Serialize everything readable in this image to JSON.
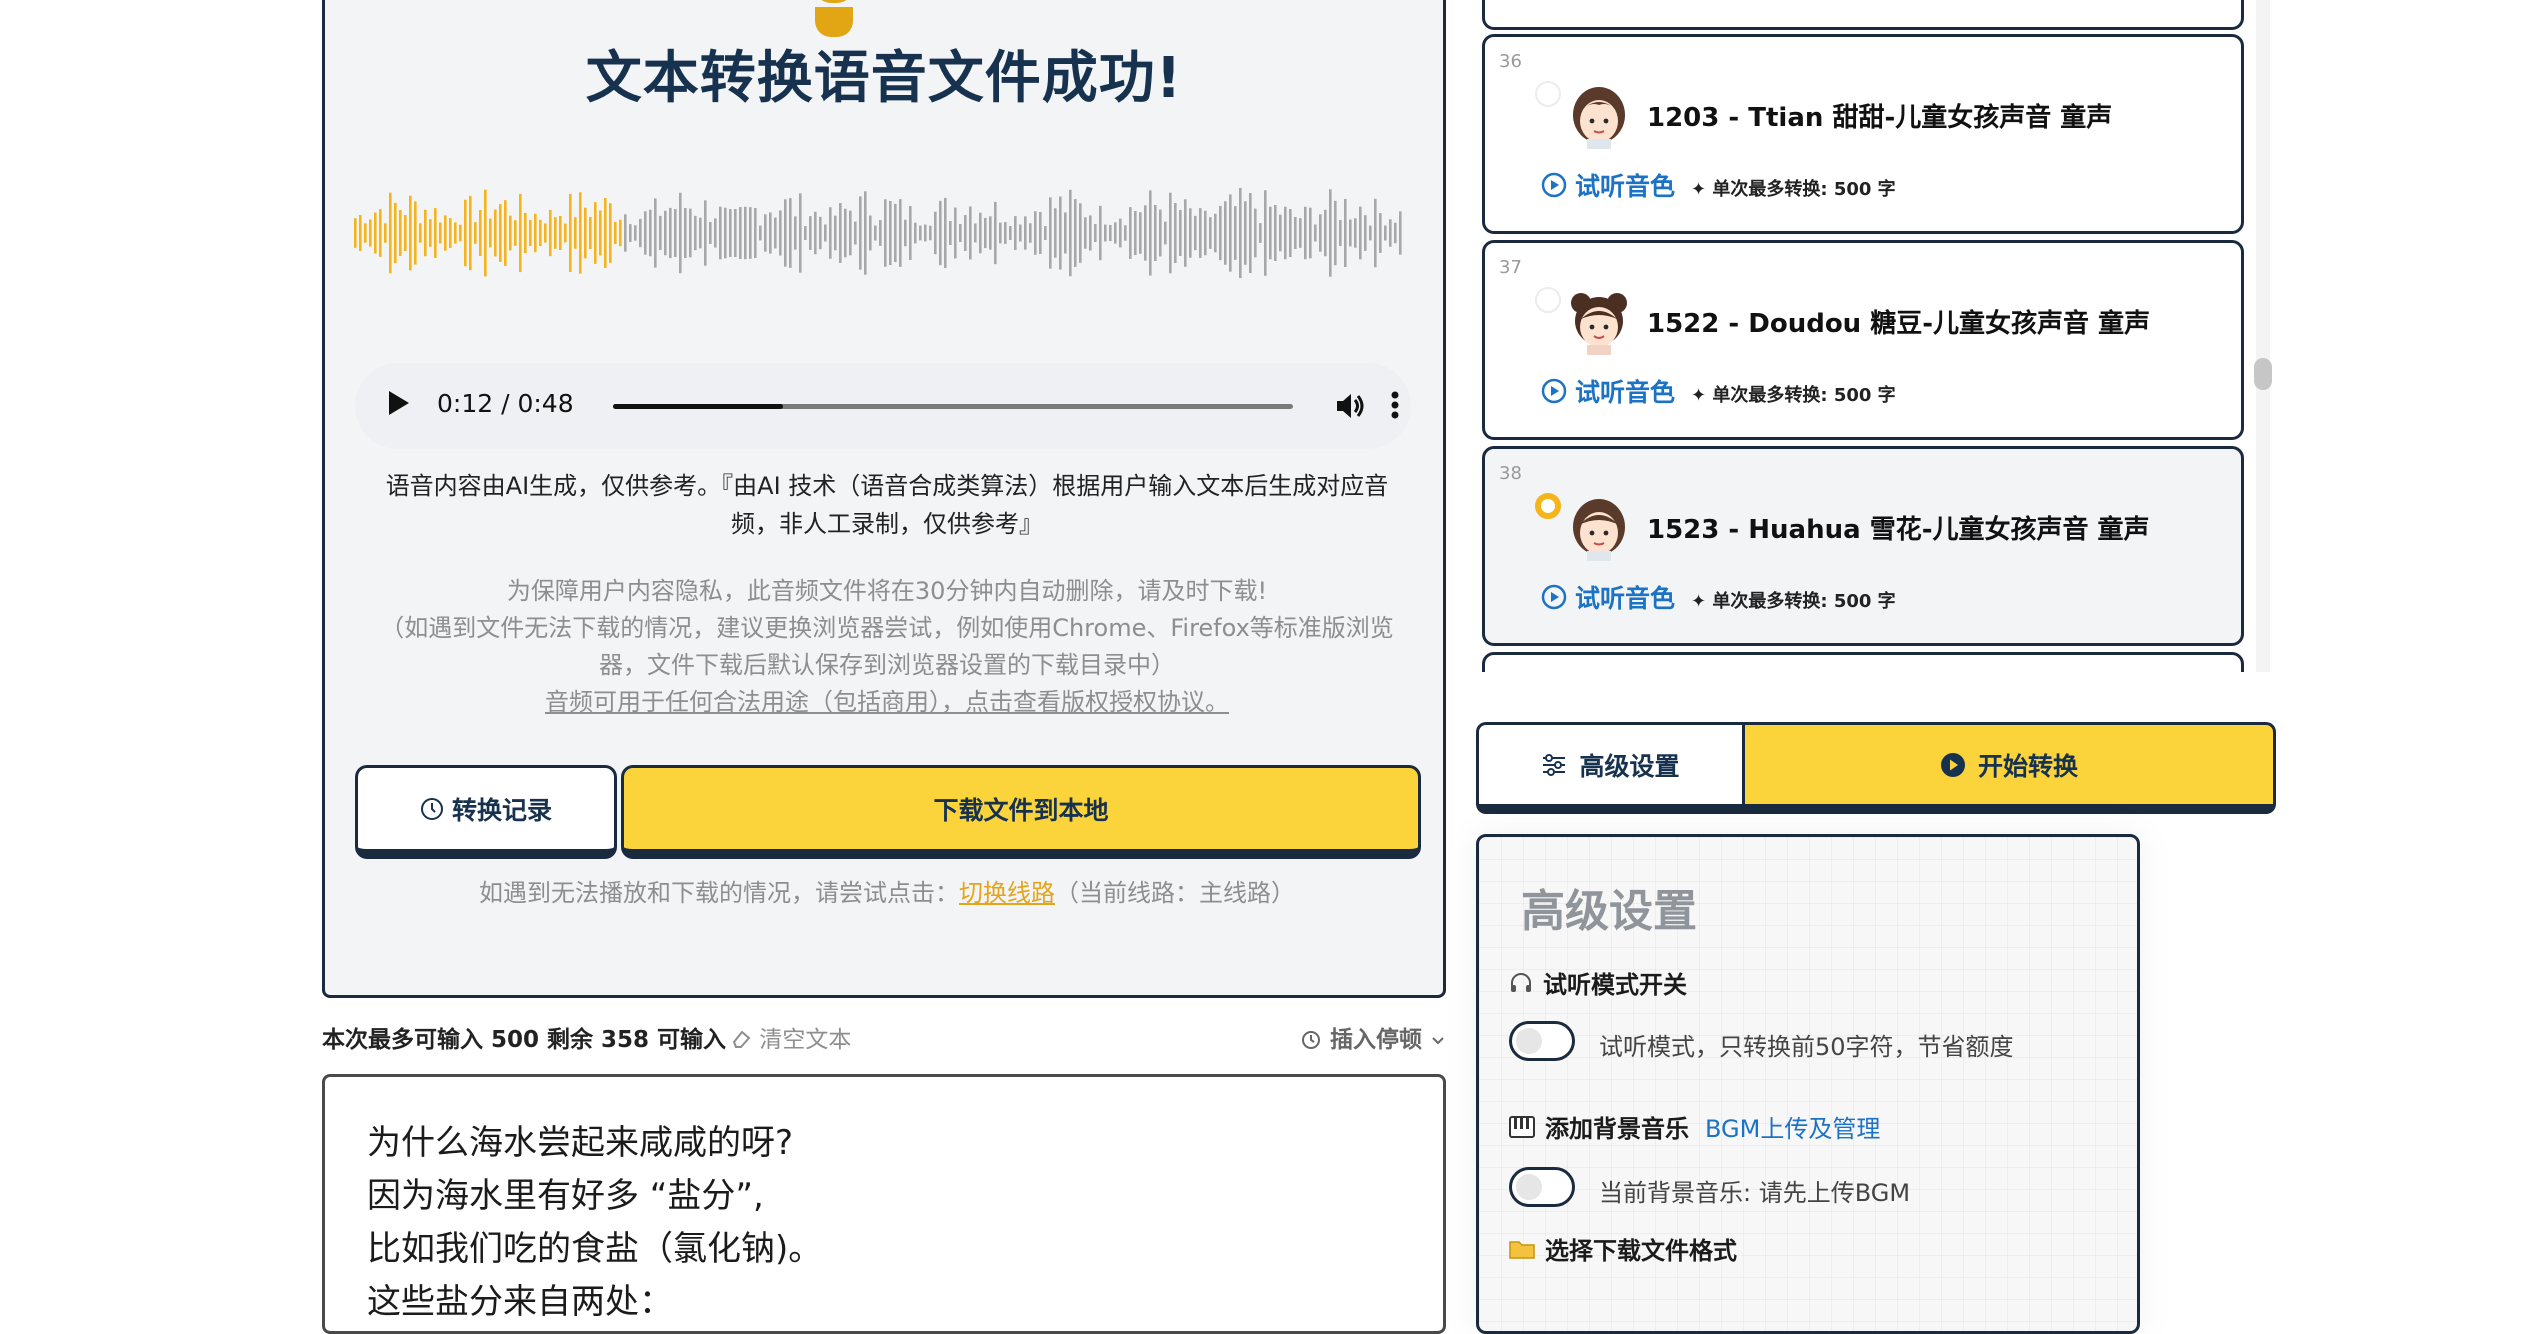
{
  "result": {
    "title": "文本转换语音文件成功!",
    "player": {
      "time": "0:12 / 0:48",
      "progress": 0.25
    },
    "disclaimer_line1": "语音内容由AI生成，仅供参考。『由AI 技术（语音合成类算法）根据用户输入文本后生成对应音",
    "disclaimer_line2": "频，非人工录制，仅供参考』",
    "privacy_line1": "为保障用户内容隐私，此音频文件将在30分钟内自动删除，请及时下载!",
    "privacy_line2": "（如遇到文件无法下载的情况，建议更换浏览器尝试，例如使用Chrome、Firefox等标准版浏览",
    "privacy_line3": "器，文件下载后默认保存到浏览器设置的下载目录中）",
    "license_link": "音频可用于任何合法用途（包括商用），点击查看版权授权协议。",
    "history_button": "转换记录",
    "download_button": "下载文件到本地",
    "switch_prefix": "如遇到无法播放和下载的情况，请尝试点击：",
    "switch_link": "切换线路",
    "switch_suffix": "（当前线路：主线路）",
    "accent_color": "#f4b41a"
  },
  "input": {
    "count_text": "本次最多可输入 500 剩余 358 可输入",
    "clear_label": "清空文本",
    "insert_pause_label": "插入停顿",
    "lines": [
      "为什么海水尝起来咸咸的呀?",
      "因为海水里有好多 “盐分”,",
      "比如我们吃的食盐（氯化钠)。",
      "这些盐分来自两处："
    ]
  },
  "voices": [
    {
      "num": "36",
      "name": "1203 - Ttian 甜甜-儿童女孩声音 童声",
      "preview": "试听音色",
      "limit": "单次最多转换: 500 字",
      "selected": false
    },
    {
      "num": "37",
      "name": "1522 - Doudou 糖豆-儿童女孩声音 童声",
      "preview": "试听音色",
      "limit": "单次最多转换: 500 字",
      "selected": false
    },
    {
      "num": "38",
      "name": "1523 - Huahua 雪花-儿童女孩声音 童声",
      "preview": "试听音色",
      "limit": "单次最多转换: 500 字",
      "selected": true
    }
  ],
  "actions": {
    "advanced_button": "高级设置",
    "start_button": "开始转换",
    "primary_color": "#fbd33a",
    "border_color": "#1a2a3f"
  },
  "advanced": {
    "title": "高级设置",
    "preview_mode_label": "试听模式开关",
    "preview_mode_desc": "试听模式，只转换前50字符，节省额度",
    "bgm_label": "添加背景音乐",
    "bgm_link": "BGM上传及管理",
    "bgm_desc": "当前背景音乐: 请先上传BGM",
    "format_label": "选择下载文件格式"
  }
}
